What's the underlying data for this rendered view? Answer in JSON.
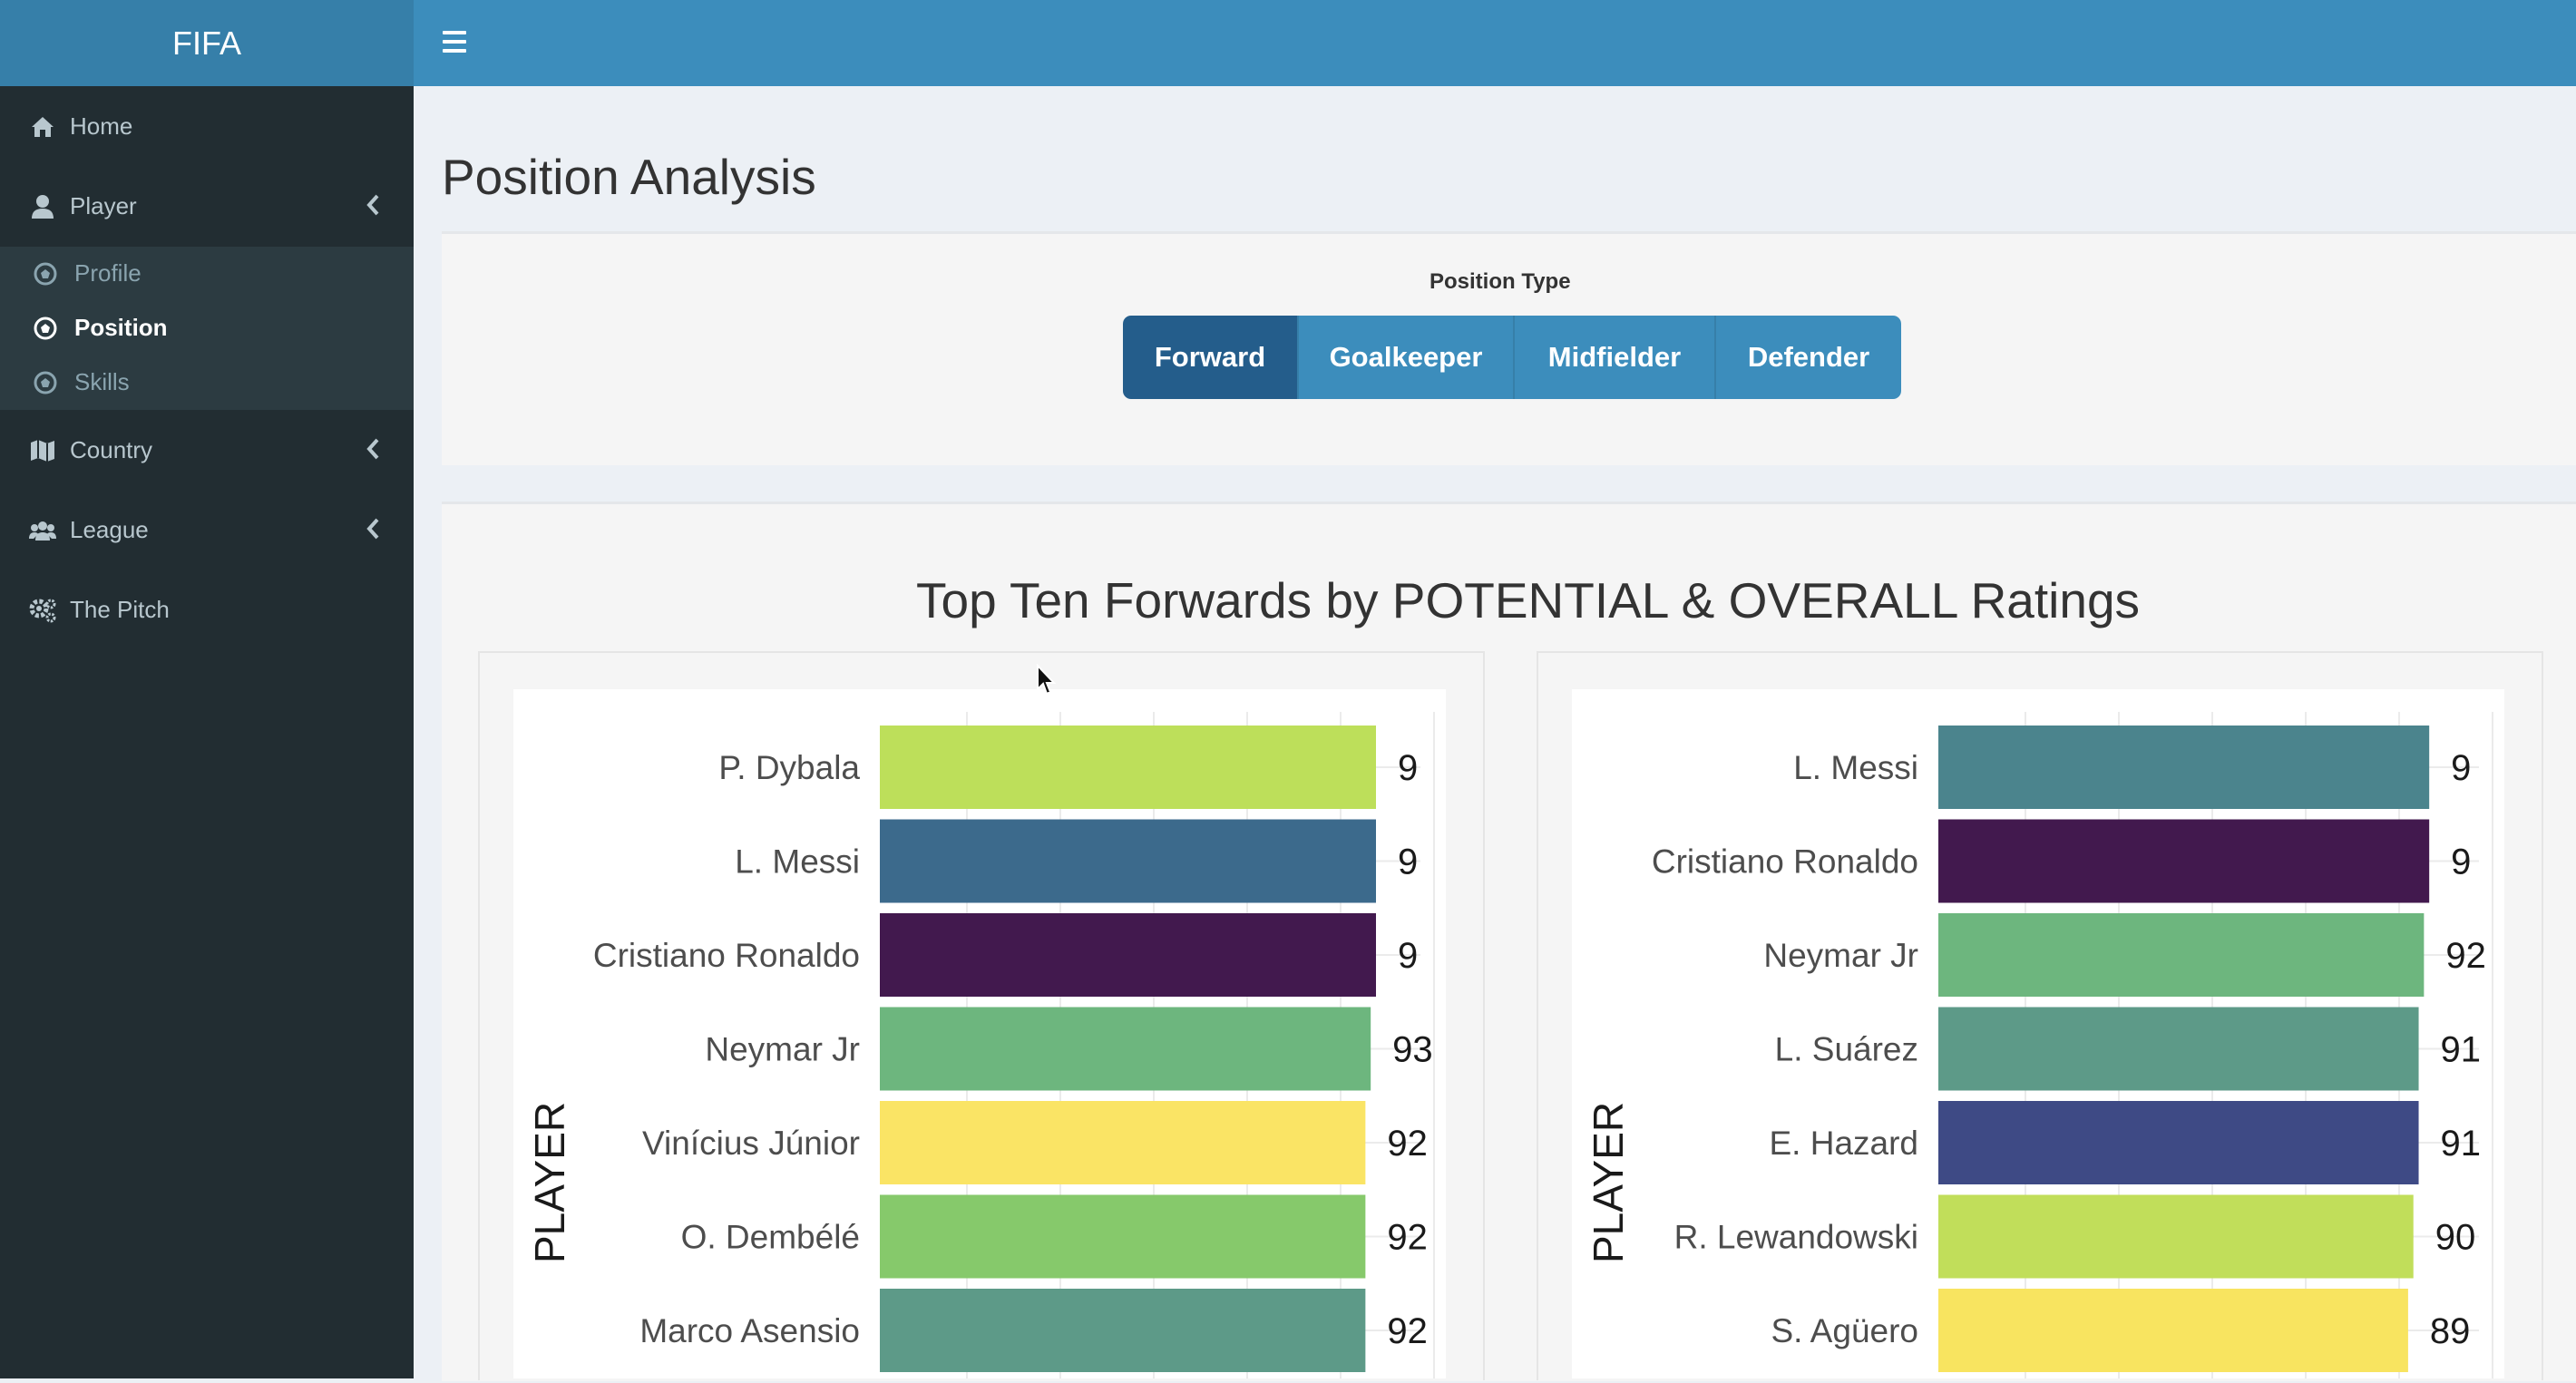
{
  "app": {
    "logo": "FIFA"
  },
  "sidebar": {
    "items": [
      {
        "label": "Home",
        "icon": "home-icon"
      },
      {
        "label": "Player",
        "icon": "user-icon"
      },
      {
        "label": "Country",
        "icon": "map-icon"
      },
      {
        "label": "League",
        "icon": "users-icon"
      },
      {
        "label": "The Pitch",
        "icon": "cogs-icon"
      }
    ],
    "player_submenu": [
      {
        "label": "Profile",
        "icon": "soccer-ball-icon"
      },
      {
        "label": "Position",
        "icon": "soccer-ball-icon",
        "active": true
      },
      {
        "label": "Skills",
        "icon": "soccer-ball-icon"
      }
    ]
  },
  "main": {
    "title": "Position Analysis",
    "position_type_label": "Position Type",
    "position_buttons": [
      "Forward",
      "Goalkeeper",
      "Midfielder",
      "Defender"
    ],
    "selected_position": "Forward",
    "chart_title": "Top Ten Forwards by POTENTIAL & OVERALL Ratings"
  },
  "colors": {
    "sidebar_bg": "#222d32",
    "submenu_bg": "#2c3b41",
    "header": "#3c8dbc",
    "logo_bg": "#367fa9",
    "active_button": "#245d8b"
  },
  "chart_data": [
    {
      "type": "bar",
      "orientation": "horizontal",
      "ylabel": "PLAYER",
      "categories": [
        "P. Dybala",
        "L. Messi",
        "Cristiano Ronaldo",
        "Neymar Jr",
        "Vinícius Júnior",
        "O. Dembélé",
        "Marco Asensio"
      ],
      "values": [
        94,
        94,
        94,
        93,
        92,
        92,
        92
      ],
      "labels": [
        "9",
        "9",
        "9",
        "93",
        "92",
        "92",
        "92"
      ],
      "colors": [
        "#bddf5a",
        "#3c6a8c",
        "#42194e",
        "#6db67e",
        "#fae465",
        "#86c96b",
        "#5d9a88"
      ],
      "grid": true
    },
    {
      "type": "bar",
      "orientation": "horizontal",
      "ylabel": "PLAYER",
      "categories": [
        "L. Messi",
        "Cristiano Ronaldo",
        "Neymar Jr",
        "L. Suárez",
        "E. Hazard",
        "R. Lewandowski",
        "S. Agüero"
      ],
      "values": [
        93,
        93,
        92,
        91,
        91,
        90,
        89
      ],
      "labels": [
        "9",
        "9",
        "92",
        "91",
        "91",
        "90",
        "89"
      ],
      "colors": [
        "#4b848d",
        "#42194e",
        "#6db67e",
        "#5d9a88",
        "#3e4a85",
        "#c1de5a",
        "#f8e460"
      ],
      "grid": true
    }
  ]
}
